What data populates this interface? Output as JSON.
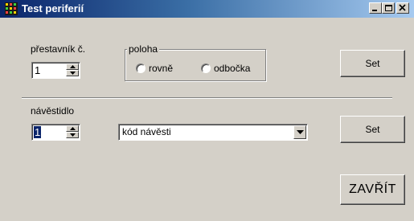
{
  "window": {
    "title": "Test periferií",
    "icon": "app-icon"
  },
  "titlebar_buttons": [
    "minimize-icon",
    "maximize-icon",
    "close-icon"
  ],
  "switch": {
    "label": "přestavník č.",
    "number_value": "1",
    "position_group": {
      "legend": "poloha",
      "options": [
        "rovně",
        "odbočka"
      ]
    },
    "set_label": "Set"
  },
  "signal": {
    "label": "návěstidlo",
    "number_value": "1",
    "code_select_value": "kód návěsti",
    "set_label": "Set"
  },
  "close_label": "ZAVŘÍT"
}
